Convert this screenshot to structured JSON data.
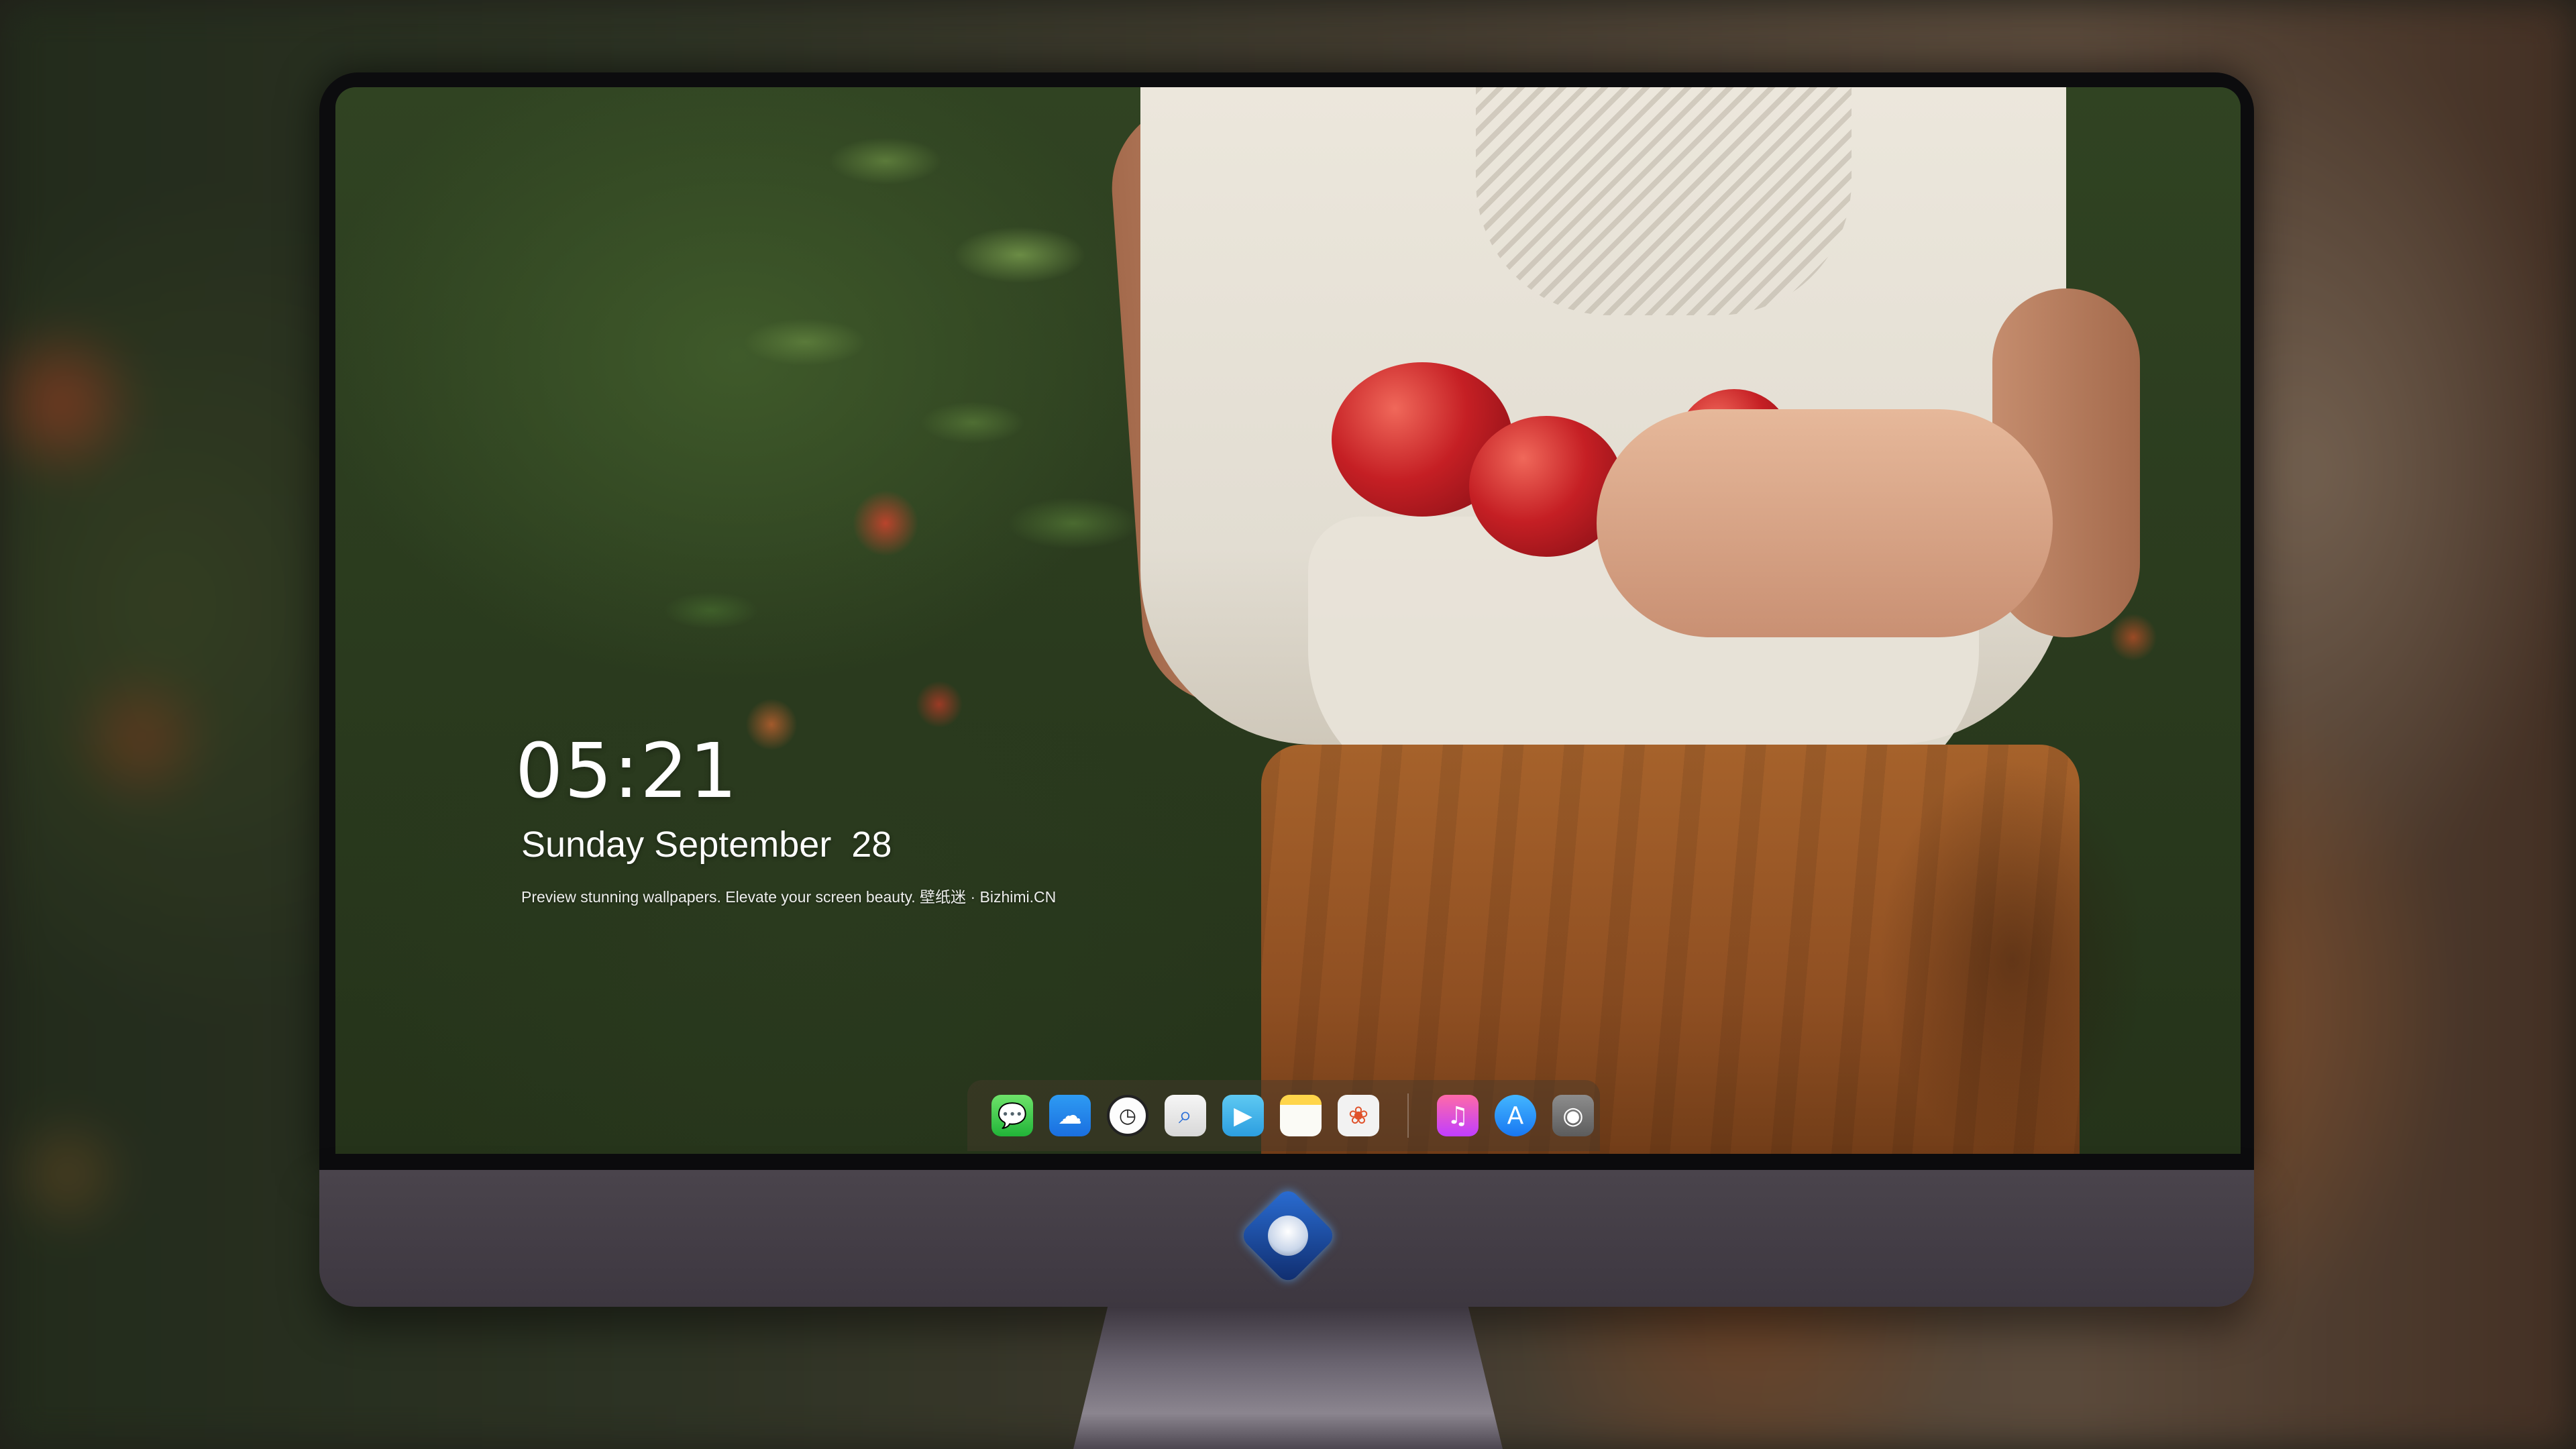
{
  "lock_screen": {
    "time": "05:21",
    "date": "Sunday September  28",
    "tagline": "Preview stunning wallpapers. Elevate your screen beauty. 壁纸迷 · Bizhimi.CN"
  },
  "dock": {
    "apps": [
      {
        "name": "Messages",
        "icon": "messages-icon",
        "glyph": "💬"
      },
      {
        "name": "Weather",
        "icon": "weather-icon",
        "glyph": "☁"
      },
      {
        "name": "Clock",
        "icon": "clock-icon",
        "glyph": "◷"
      },
      {
        "name": "Preview",
        "icon": "preview-icon",
        "glyph": "⌕"
      },
      {
        "name": "Clips",
        "icon": "clips-icon",
        "glyph": "▶"
      },
      {
        "name": "Notes",
        "icon": "notes-icon",
        "glyph": ""
      },
      {
        "name": "Photos",
        "icon": "photos-icon",
        "glyph": "❀"
      },
      {
        "name": "iTunes",
        "icon": "music-icon",
        "glyph": "♫"
      },
      {
        "name": "App Store",
        "icon": "app-store-icon",
        "glyph": "A"
      },
      {
        "name": "Camera",
        "icon": "camera-icon",
        "glyph": "◉"
      }
    ]
  },
  "colors": {
    "bezel": "#0c0c0e",
    "chin": "#433d46",
    "text": "#ffffff"
  }
}
